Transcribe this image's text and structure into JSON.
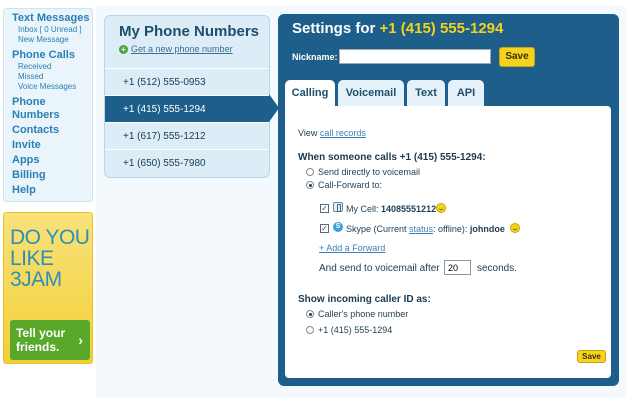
{
  "nav": {
    "text_messages": "Text Messages",
    "inbox": "Inbox [ 0 Unread ]",
    "new_message": "New Message",
    "phone_calls": "Phone Calls",
    "received": "Received",
    "missed": "Missed",
    "voice_messages": "Voice Messages",
    "phone_numbers": "Phone Numbers",
    "contacts": "Contacts",
    "invite": "Invite",
    "apps": "Apps",
    "billing": "Billing",
    "help": "Help"
  },
  "ad": {
    "headline": "DO YOU LIKE 3JAM",
    "button_label": "Tell your friends.",
    "button_arrow": "›"
  },
  "phone_numbers": {
    "title": "My Phone Numbers",
    "get_new": "Get a new phone number",
    "items": [
      {
        "number": "+1 (512) 555-0953",
        "selected": false
      },
      {
        "number": "+1 (415) 555-1294",
        "selected": true
      },
      {
        "number": "+1 (617) 555-1212",
        "selected": false
      },
      {
        "number": "+1 (650) 555-7980",
        "selected": false
      }
    ]
  },
  "settings": {
    "title_prefix": "Settings for ",
    "title_number": "+1 (415) 555-1294",
    "nickname_label": "Nickname:",
    "nickname_value": "",
    "save_label": "Save",
    "tabs": [
      "Calling",
      "Voicemail",
      "Text",
      "API"
    ],
    "active_tab": "Calling",
    "content": {
      "view_prefix": "View ",
      "call_records": "call records",
      "when_heading": "When someone calls +1 (415) 555-1294:",
      "send_voicemail": "Send directly to voicemail",
      "call_forward": "Call-Forward to:",
      "my_cell_label": "My Cell: ",
      "my_cell_number": "14085551212",
      "skype_prefix": "Skype (Current ",
      "skype_status_link": "status",
      "skype_suffix": ": offline): ",
      "skype_user": "johndoe",
      "add_forward": "+ Add a Forward",
      "after_prefix": "And send to voicemail after",
      "after_value": "20",
      "after_suffix": "seconds.",
      "caller_id_heading": "Show incoming caller ID as:",
      "caller_phone": "Caller's phone number",
      "own_number": "+1 (415) 555-1294",
      "save_label": "Save"
    }
  },
  "colors": {
    "accent_yellow": "#f5d21e",
    "panel_blue": "#1d5f8a",
    "link_blue": "#2a7fb3",
    "ad_green": "#5aa82a"
  }
}
